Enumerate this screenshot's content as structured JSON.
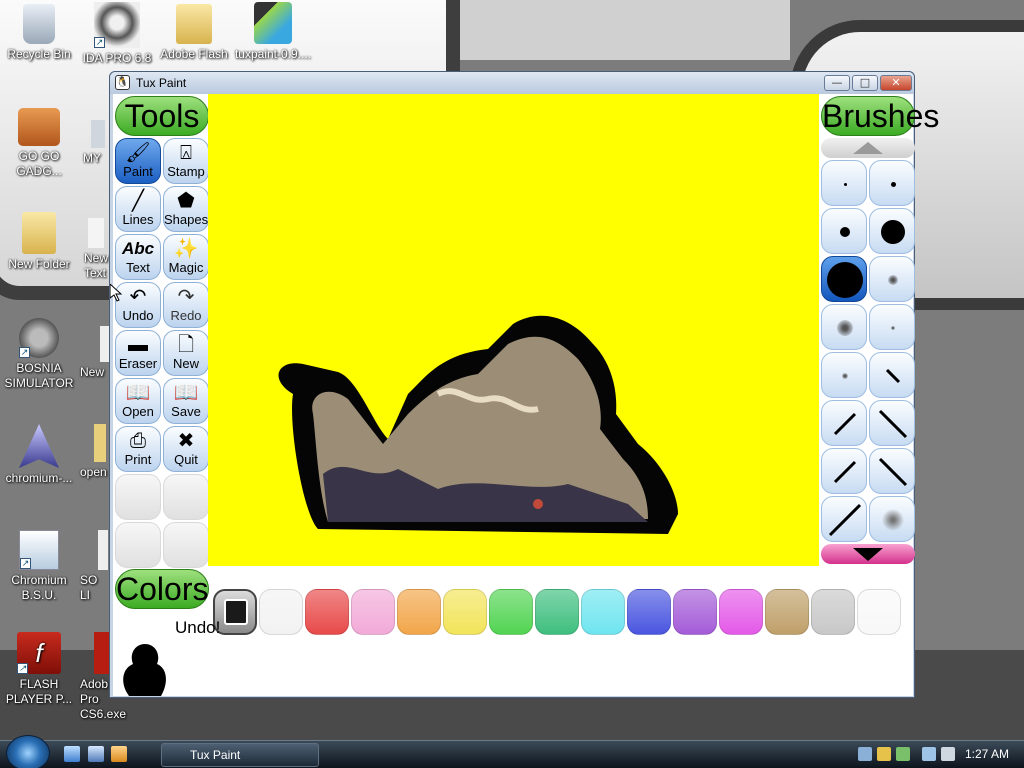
{
  "desktop": {
    "icons": [
      {
        "name": "recycle-bin",
        "label": "Recycle Bin"
      },
      {
        "name": "ida-pro",
        "label": "IDA PRO 6.8"
      },
      {
        "name": "adobe-flash-folder",
        "label": "Adobe Flash"
      },
      {
        "name": "tuxpaint-installer",
        "label": "tuxpaint-0.9...."
      },
      {
        "name": "go-go-gadget",
        "label": "GO GO GADG..."
      },
      {
        "name": "my-partial",
        "label": "MY"
      },
      {
        "name": "new-folder",
        "label": "New Folder"
      },
      {
        "name": "new-text",
        "label": "New Text"
      },
      {
        "name": "bosnia-simulator",
        "label": "BOSNIA SIMULATOR"
      },
      {
        "name": "new-partial",
        "label": "New"
      },
      {
        "name": "chromium",
        "label": "chromium-..."
      },
      {
        "name": "open-partial",
        "label": "open"
      },
      {
        "name": "chromium-bsu",
        "label": "Chromium B.S.U."
      },
      {
        "name": "so-partial",
        "label": "SO LI"
      },
      {
        "name": "flash-player",
        "label": "FLASH PLAYER P..."
      },
      {
        "name": "adobe-cs6",
        "label": "Adob Pro CS6.exe"
      }
    ]
  },
  "window": {
    "title": "Tux Paint",
    "minimize_glyph": "—",
    "maximize_glyph": "□",
    "close_glyph": "✕"
  },
  "tuxpaint": {
    "tools_header": "Tools",
    "brushes_header": "Brushes",
    "colors_header": "Colors",
    "tools": [
      {
        "name": "paint",
        "label": "Paint",
        "glyph": "🖌",
        "selected": true
      },
      {
        "name": "stamp",
        "label": "Stamp",
        "glyph": "⍓"
      },
      {
        "name": "lines",
        "label": "Lines",
        "glyph": "╱"
      },
      {
        "name": "shapes",
        "label": "Shapes",
        "glyph": "⬟"
      },
      {
        "name": "text",
        "label": "Text",
        "glyph": "Abc"
      },
      {
        "name": "magic",
        "label": "Magic",
        "glyph": "✨"
      },
      {
        "name": "undo",
        "label": "Undo",
        "glyph": "↶"
      },
      {
        "name": "redo",
        "label": "Redo",
        "glyph": "↷"
      },
      {
        "name": "eraser",
        "label": "Eraser",
        "glyph": "▬"
      },
      {
        "name": "new",
        "label": "New",
        "glyph": "🗋"
      },
      {
        "name": "open",
        "label": "Open",
        "glyph": "📖"
      },
      {
        "name": "save",
        "label": "Save",
        "glyph": "📖"
      },
      {
        "name": "print",
        "label": "Print",
        "glyph": "⎙"
      },
      {
        "name": "quit",
        "label": "Quit",
        "glyph": "✖"
      }
    ],
    "brushes": [
      {
        "kind": "dot-tiny"
      },
      {
        "kind": "dot-small"
      },
      {
        "kind": "dot-medium"
      },
      {
        "kind": "dot-large"
      },
      {
        "kind": "dot-xlarge",
        "selected": true
      },
      {
        "kind": "fuzzy-medium"
      },
      {
        "kind": "fuzzy-large"
      },
      {
        "kind": "fuzzy-small"
      },
      {
        "kind": "fuzzy-tiny"
      },
      {
        "kind": "slash-small"
      },
      {
        "kind": "slash-medium"
      },
      {
        "kind": "slash-large"
      },
      {
        "kind": "slash-medium-2"
      },
      {
        "kind": "slash-large-2"
      },
      {
        "kind": "slash-xlarge"
      },
      {
        "kind": "splatter"
      }
    ],
    "colors": [
      "#1a1a1a",
      "#f2f2f2",
      "#e84a4a",
      "#f2aad8",
      "#f2a64a",
      "#f2e45a",
      "#52d452",
      "#3fbf7f",
      "#6fe5ef",
      "#4a56e0",
      "#a45cd8",
      "#e45ae8",
      "#bfa06a",
      "#c8c8c8",
      "#f8f8f8"
    ],
    "status_text": "Undo!",
    "canvas_color": "#ffff00",
    "selected_color_index": 0
  },
  "taskbar": {
    "active_app": "Tux Paint",
    "clock": "1:27 AM"
  }
}
